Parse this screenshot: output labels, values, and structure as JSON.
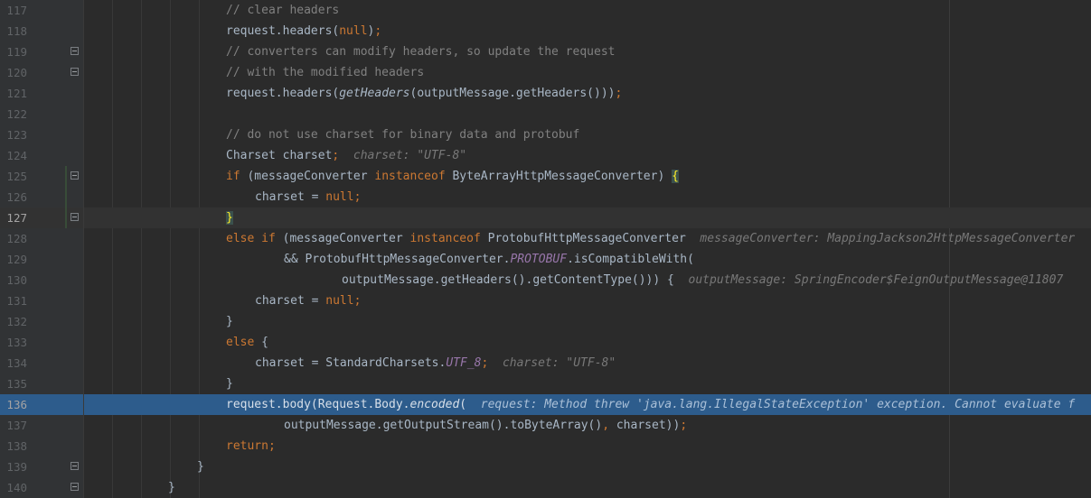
{
  "editor": {
    "lines": [
      {
        "num": "117",
        "indent": 250,
        "segs": [
          {
            "t": "// clear headers",
            "c": "c-comment"
          }
        ]
      },
      {
        "num": "118",
        "indent": 250,
        "segs": [
          {
            "t": "request.headers("
          },
          {
            "t": "null",
            "c": "c-kw"
          },
          {
            "t": ")"
          },
          {
            "t": ";",
            "c": "c-kw"
          }
        ]
      },
      {
        "num": "119",
        "indent": 250,
        "fold": true,
        "segs": [
          {
            "t": "// converters can modify headers, so update the request",
            "c": "c-comment"
          }
        ]
      },
      {
        "num": "120",
        "indent": 250,
        "fold": true,
        "segs": [
          {
            "t": "// with the modified headers",
            "c": "c-comment"
          }
        ]
      },
      {
        "num": "121",
        "indent": 250,
        "segs": [
          {
            "t": "request.headers("
          },
          {
            "t": "getHeaders",
            "c": "c-method-it"
          },
          {
            "t": "(outputMessage.getHeaders()))"
          },
          {
            "t": ";",
            "c": "c-kw"
          }
        ]
      },
      {
        "num": "122",
        "indent": 250,
        "segs": []
      },
      {
        "num": "123",
        "indent": 250,
        "segs": [
          {
            "t": "// do not use charset for binary data and protobuf",
            "c": "c-comment"
          }
        ]
      },
      {
        "num": "124",
        "indent": 250,
        "segs": [
          {
            "t": "Charset charset"
          },
          {
            "t": ";",
            "c": "c-kw"
          },
          {
            "t": "  charset: \"UTF-8\"",
            "c": "c-hint"
          }
        ]
      },
      {
        "num": "125",
        "indent": 250,
        "fold": true,
        "change": true,
        "segs": [
          {
            "t": "if",
            "c": "c-kw"
          },
          {
            "t": " (messageConverter "
          },
          {
            "t": "instanceof",
            "c": "c-kw"
          },
          {
            "t": " ByteArrayHttpMessageConverter) "
          },
          {
            "t": "{",
            "c": "brace-match"
          }
        ]
      },
      {
        "num": "126",
        "indent": 282,
        "change": true,
        "segs": [
          {
            "t": "charset = "
          },
          {
            "t": "null",
            "c": "c-kw"
          },
          {
            "t": ";",
            "c": "c-kw"
          }
        ]
      },
      {
        "num": "127",
        "indent": 250,
        "fold": true,
        "change": true,
        "current": true,
        "segs": [
          {
            "t": "}",
            "c": "brace-match"
          }
        ]
      },
      {
        "num": "128",
        "indent": 250,
        "segs": [
          {
            "t": "else if",
            "c": "c-kw"
          },
          {
            "t": " (messageConverter "
          },
          {
            "t": "instanceof",
            "c": "c-kw"
          },
          {
            "t": " ProtobufHttpMessageConverter"
          },
          {
            "t": "  messageConverter: MappingJackson2HttpMessageConverter",
            "c": "c-hint"
          }
        ]
      },
      {
        "num": "129",
        "indent": 314,
        "segs": [
          {
            "t": "&& ProtobufHttpMessageConverter."
          },
          {
            "t": "PROTOBUF",
            "c": "c-const"
          },
          {
            "t": ".isCompatibleWith("
          }
        ]
      },
      {
        "num": "130",
        "indent": 378,
        "segs": [
          {
            "t": "outputMessage.getHeaders().getContentType())) {"
          },
          {
            "t": "  outputMessage: SpringEncoder$FeignOutputMessage@11807",
            "c": "c-hint"
          }
        ]
      },
      {
        "num": "131",
        "indent": 282,
        "segs": [
          {
            "t": "charset = "
          },
          {
            "t": "null",
            "c": "c-kw"
          },
          {
            "t": ";",
            "c": "c-kw"
          }
        ]
      },
      {
        "num": "132",
        "indent": 250,
        "segs": [
          {
            "t": "}"
          }
        ]
      },
      {
        "num": "133",
        "indent": 250,
        "segs": [
          {
            "t": "else",
            "c": "c-kw"
          },
          {
            "t": " {"
          }
        ]
      },
      {
        "num": "134",
        "indent": 282,
        "segs": [
          {
            "t": "charset = StandardCharsets."
          },
          {
            "t": "UTF_8",
            "c": "c-const"
          },
          {
            "t": ";",
            "c": "c-kw"
          },
          {
            "t": "  charset: \"UTF-8\"",
            "c": "c-hint"
          }
        ]
      },
      {
        "num": "135",
        "indent": 250,
        "segs": [
          {
            "t": "}"
          }
        ]
      },
      {
        "num": "136",
        "indent": 250,
        "exec": true,
        "segs": [
          {
            "t": "request.body(Request.Body."
          },
          {
            "t": "encoded",
            "c": "c-italic"
          },
          {
            "t": "("
          },
          {
            "t": "  request: Method threw 'java.lang.IllegalStateException' exception. Cannot evaluate f",
            "c": "c-hint"
          }
        ]
      },
      {
        "num": "137",
        "indent": 314,
        "segs": [
          {
            "t": "outputMessage.getOutputStream().toByteArray()"
          },
          {
            "t": ",",
            "c": "c-kw"
          },
          {
            "t": " charset))"
          },
          {
            "t": ";",
            "c": "c-kw"
          }
        ]
      },
      {
        "num": "138",
        "indent": 250,
        "segs": [
          {
            "t": "return",
            "c": "c-kw"
          },
          {
            "t": ";",
            "c": "c-kw"
          }
        ]
      },
      {
        "num": "139",
        "indent": 218,
        "fold": true,
        "segs": [
          {
            "t": "}"
          }
        ]
      },
      {
        "num": "140",
        "indent": 186,
        "fold": true,
        "segs": [
          {
            "t": "}"
          }
        ]
      }
    ]
  }
}
